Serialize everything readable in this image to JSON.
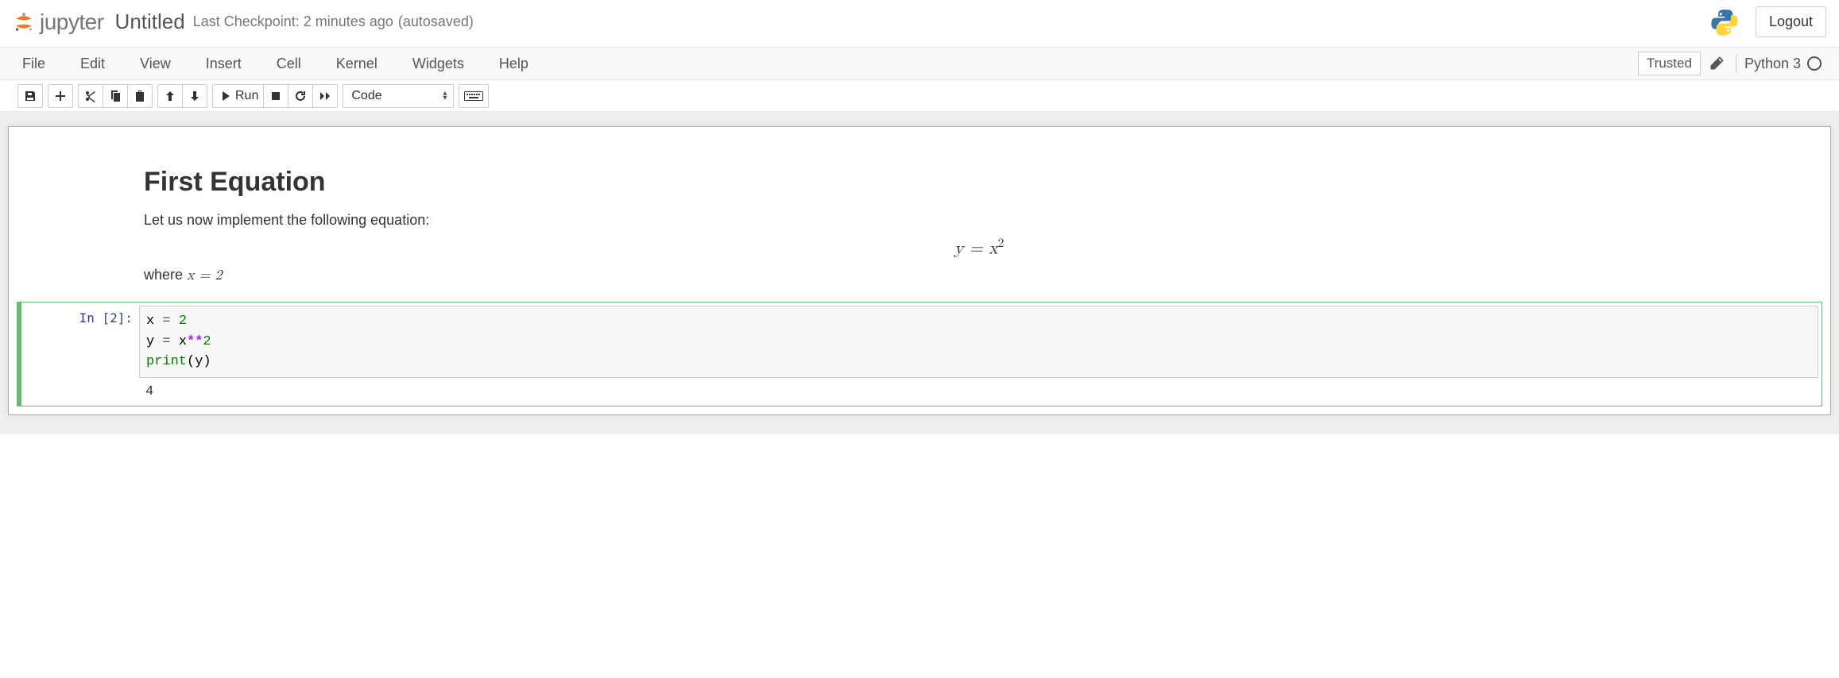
{
  "header": {
    "logo_text": "jupyter",
    "notebook_name": "Untitled",
    "checkpoint": "Last Checkpoint: 2 minutes ago",
    "autosave": "(autosaved)",
    "logout": "Logout"
  },
  "menubar": {
    "items": [
      "File",
      "Edit",
      "View",
      "Insert",
      "Cell",
      "Kernel",
      "Widgets",
      "Help"
    ],
    "trusted": "Trusted",
    "kernel_name": "Python 3"
  },
  "toolbar": {
    "run_label": "Run",
    "celltype": "Code"
  },
  "notebook": {
    "markdown": {
      "heading": "First Equation",
      "para1": "Let us now implement the following equation:",
      "equation": "y = x",
      "equation_sup": "2",
      "para2_pre": "where ",
      "para2_math": "x = 2"
    },
    "code": {
      "prompt": "In [2]:",
      "line1_var": "x",
      "line1_eq": " = ",
      "line1_val": "2",
      "line2_var": "y",
      "line2_eq": " = ",
      "line2_rhs1": "x",
      "line2_op": "**",
      "line2_rhs2": "2",
      "line3_fn": "print",
      "line3_arg": "(y)",
      "output": "4"
    }
  }
}
